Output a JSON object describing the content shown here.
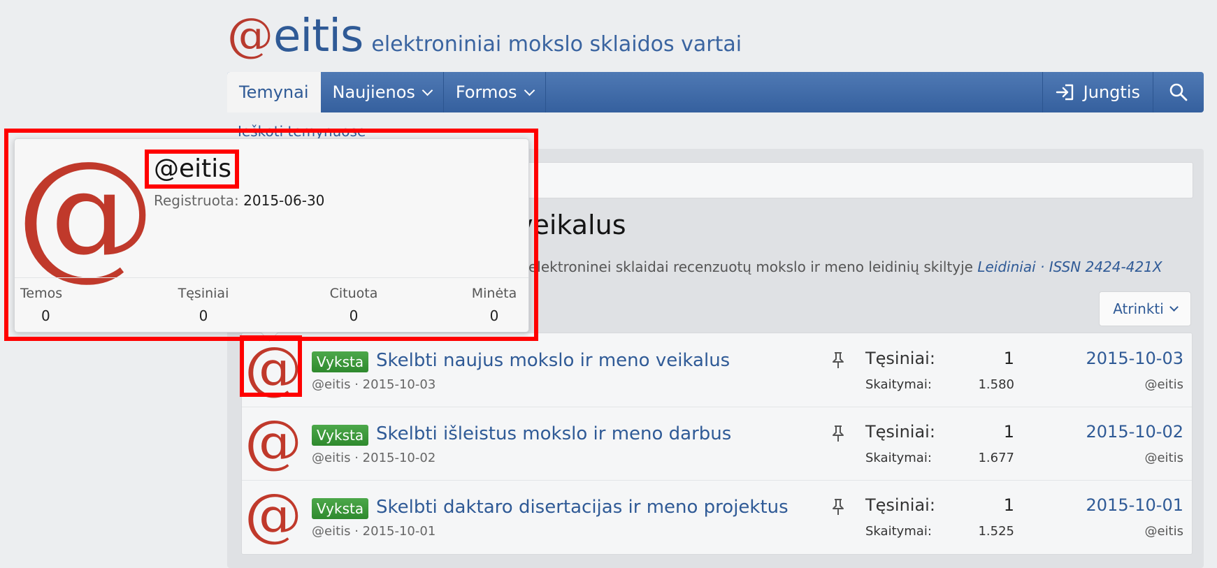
{
  "site": {
    "logo_at": "@",
    "logo_word": "eitis",
    "tagline": "elektroniniai mokslo sklaidos vartai"
  },
  "nav": {
    "items": [
      {
        "label": "Temynai",
        "active": true
      },
      {
        "label": "Naujienos",
        "dropdown": true
      },
      {
        "label": "Formos",
        "dropdown": true
      }
    ],
    "login": "Jungtis"
  },
  "sublink": "Ieškoti temynuose",
  "forum": {
    "title_visible": "veikalus",
    "description": "elektroninei sklaidai recenzuotų mokslo ir meno leidinių skiltyje",
    "description_link": "Leidiniai · ISSN 2424-421X",
    "filter_label": "Atrinkti"
  },
  "threads": [
    {
      "badge": "Vyksta",
      "title": "Skelbti naujus mokslo ir meno veikalus",
      "meta": "@eitis · 2015-10-03",
      "replies_label": "Tęsiniai:",
      "replies": "1",
      "views_label": "Skaitymai:",
      "views": "1.580",
      "last_date": "2015-10-03",
      "last_user": "@eitis"
    },
    {
      "badge": "Vyksta",
      "title": "Skelbti išleistus mokslo ir meno darbus",
      "meta": "@eitis · 2015-10-02",
      "replies_label": "Tęsiniai:",
      "replies": "1",
      "views_label": "Skaitymai:",
      "views": "1.677",
      "last_date": "2015-10-02",
      "last_user": "@eitis"
    },
    {
      "badge": "Vyksta",
      "title": "Skelbti daktaro disertacijas ir meno projektus",
      "meta": "@eitis · 2015-10-01",
      "replies_label": "Tęsiniai:",
      "replies": "1",
      "views_label": "Skaitymai:",
      "views": "1.525",
      "last_date": "2015-10-01",
      "last_user": "@eitis"
    }
  ],
  "member_card": {
    "avatar_glyph": "@",
    "name": "@eitis",
    "registered_label": "Registruota:",
    "registered_value": "2015-06-30",
    "stats": [
      {
        "label": "Temos",
        "value": "0"
      },
      {
        "label": "Tęsiniai",
        "value": "0"
      },
      {
        "label": "Cituota",
        "value": "0"
      },
      {
        "label": "Minėta",
        "value": "0"
      }
    ]
  },
  "colors": {
    "accent": "#2f5a96",
    "nav_bg": "#4472ac",
    "logo_red": "#b83a2e",
    "badge_green": "#3a9a38",
    "highlight": "#ff0000"
  }
}
